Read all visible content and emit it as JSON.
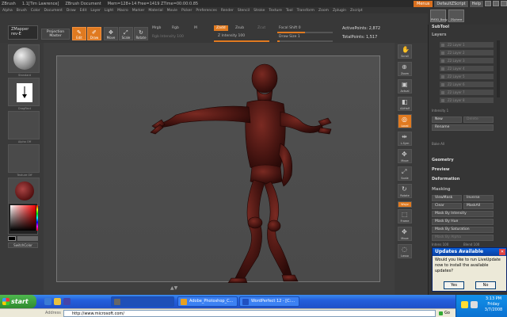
{
  "titlebar": {
    "app": "ZBrush",
    "owner": "1.1[Tim Lawrence]",
    "doc": "ZBrush Document",
    "mem": "Mem=128+14 Free=1419 ZTime=00:00:0.85",
    "menus_label": "Menus",
    "script_label": "DefaultZScript",
    "help_label": "Help"
  },
  "menubar": [
    "Alpha",
    "Brush",
    "Color",
    "Document",
    "Draw",
    "Edit",
    "Layer",
    "Light",
    "Macro",
    "Marker",
    "Material",
    "Movie",
    "Picker",
    "Preferences",
    "Render",
    "Stencil",
    "Stroke",
    "Texture",
    "Tool",
    "Transform",
    "Zoom",
    "Zplugin",
    "Zscript"
  ],
  "shelf": {
    "thumb1": "PM3D_Body_Z2b",
    "thumb2": "ZSphere"
  },
  "toolbar": {
    "zmapper_line1": "ZMapper",
    "zmapper_line2": "rev-E",
    "projection_line1": "Projection",
    "projection_line2": "Master",
    "edit_label": "Edit",
    "draw_label": "Draw",
    "move_label": "Move",
    "scale_label": "Scale",
    "rotate_label": "Rotate",
    "mrgb": "Mrgb",
    "rgb": "Rgb",
    "m": "M",
    "rgb_intensity": "Rgb Intensity 100",
    "zadd": "Zadd",
    "zsub": "Zsub",
    "zcut": "Zcut",
    "z_intensity": "Z Intensity 100",
    "focal_shift": "Focal Shift 0",
    "draw_size": "Draw Size 1",
    "active_points": "ActivePoints: 2,872",
    "total_points": "TotalPoints: 1,517",
    "z_intensity_level": 1.0,
    "focal_shift_level": 0.5,
    "draw_size_level": 0.02
  },
  "lefttray": {
    "brush_label": "Standard",
    "stroke_label": "DragRect",
    "alpha_label": "Alpha Off",
    "texture_label": "Texture Off",
    "material_label": "MatCap Red Wax",
    "switch_label": "SwitchColor"
  },
  "rightstrip": [
    {
      "label": "Scroll",
      "icon": "hand-icon"
    },
    {
      "label": "Zoom",
      "icon": "zoom-icon"
    },
    {
      "label": "Actual",
      "icon": "actual-icon"
    },
    {
      "label": "AAHalf",
      "icon": "aahalf-icon"
    },
    {
      "label": "Local",
      "icon": "local-icon"
    },
    {
      "label": "L.Sym",
      "icon": "lsym-icon"
    },
    {
      "label": "Move",
      "icon": "move-icon"
    },
    {
      "label": "Scale",
      "icon": "scale-icon"
    },
    {
      "label": "Rotate",
      "icon": "rotate-icon"
    },
    {
      "label": "Frame",
      "icon": "frame-icon"
    },
    {
      "label": "Move",
      "icon": "move-icon"
    },
    {
      "label": "Lasso",
      "icon": "lasso-icon"
    }
  ],
  "rightstrip_xyz": "Wxyz",
  "palette": {
    "subtool": "SubTool",
    "layers": "Layers",
    "layer_names": [
      "Z2 Layer 1",
      "Z2 Layer 2",
      "Z2 Layer 3",
      "Z2 Layer 4",
      "Z2 Layer 5",
      "Z2 Layer 6",
      "Z2 Layer 7",
      "Z2 Layer 8"
    ],
    "intensity": "Intensity 1",
    "new": "New",
    "delete": "Delete",
    "rename": "Rename",
    "bake_all": "Bake All",
    "geometry": "Geometry",
    "preview": "Preview",
    "deformation": "Deformation",
    "masking": "Masking",
    "viewmask": "ViewMask",
    "inverse": "Inverse",
    "clear": "Clear",
    "maskall": "MaskAll",
    "mask_by_intensity": "Mask By Intensity",
    "mask_by_hue": "Mask By Hue",
    "mask_by_saturation": "Mask By Saturation",
    "mask_by_alpha": "Mask By Alpha",
    "intens": "Intens 100",
    "blend": "Blend 100"
  },
  "dialog": {
    "title": "Updates Available",
    "message": "Would you like to run LiveUpdate now to install the available updates?",
    "yes": "Yes",
    "no": "No"
  },
  "taskbar": {
    "start": "start",
    "tasks": [
      {
        "label": "",
        "color": "#666"
      },
      {
        "label": "Adobe_Photoshop_C...",
        "color": "#e8a020"
      },
      {
        "label": "WordPerfect 12 - [C:...",
        "color": "#2050c0"
      }
    ],
    "time": "3:13 PM",
    "day": "Friday",
    "date": "3/7/2008"
  },
  "addressbar": {
    "label": "Address",
    "url": "http://www.microsoft.com/",
    "go": "Go"
  }
}
